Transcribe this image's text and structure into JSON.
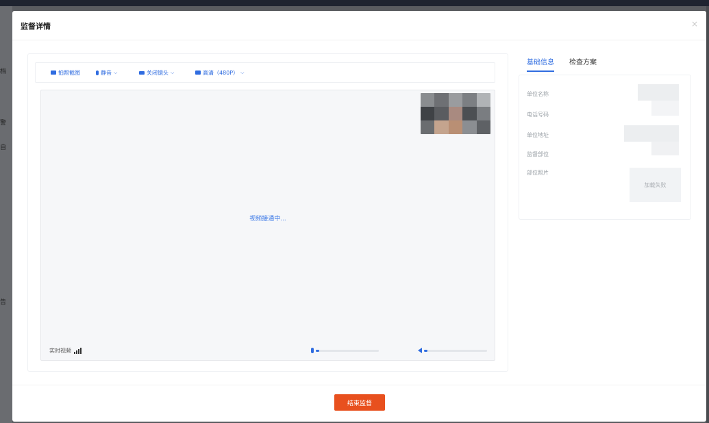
{
  "background": {
    "fragments": [
      "档",
      "警",
      "自",
      "告"
    ]
  },
  "modal": {
    "title": "监督详情",
    "close_glyph": "×"
  },
  "toolbar": {
    "screenshot_label": "拍照截图",
    "mute_label": "静音",
    "camera_label": "关闭镜头",
    "quality_label": "高清（480P）",
    "chevron": "⌵"
  },
  "video": {
    "status_text": "视频接通中...",
    "live_label": "实时视频",
    "mic_level": 0.05,
    "speaker_level": 0.05
  },
  "tabs": [
    {
      "label": "基础信息",
      "active": true
    },
    {
      "label": "检查方案",
      "active": false
    }
  ],
  "info": {
    "labels": [
      "单位名称",
      "电话号码",
      "单位地址",
      "监督部位",
      "部位照片"
    ],
    "photo_status": "加载失败"
  },
  "footer": {
    "end_button": "结束监督"
  },
  "colors": {
    "accent": "#2f6ce0",
    "danger_button": "#e8501e"
  }
}
